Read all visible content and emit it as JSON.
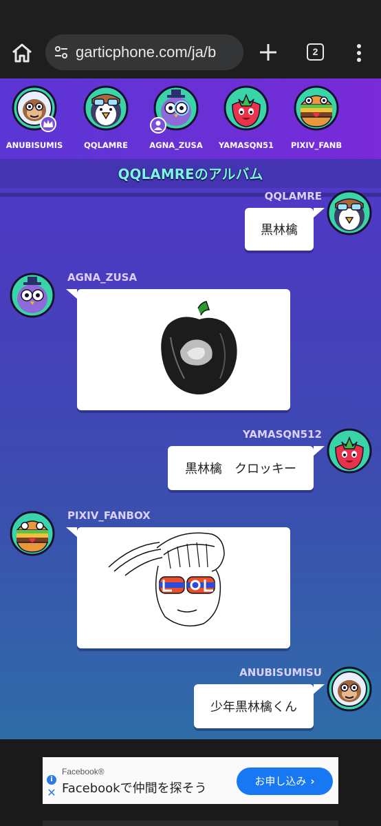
{
  "browser": {
    "url": "garticphone.com/ja/b",
    "tab_count": "2"
  },
  "players": [
    {
      "name": "ANUBISUMIS",
      "avatar": "monkey-astronaut",
      "badge": "crown-icon"
    },
    {
      "name": "QQLAMRE",
      "avatar": "penguin-pilot",
      "badge": ""
    },
    {
      "name": "AGNA_ZUSA",
      "avatar": "owl-detective",
      "badge": "user-icon"
    },
    {
      "name": "YAMASQN51",
      "avatar": "strawberry",
      "badge": ""
    },
    {
      "name": "PIXIV_FANB",
      "avatar": "burger-frog",
      "badge": ""
    }
  ],
  "album": {
    "title": "QQLAMREのアルバム"
  },
  "messages": [
    {
      "author": "QQLAMRE",
      "kind": "text",
      "text": "黒林檎",
      "side": "right"
    },
    {
      "author": "AGNA_ZUSA",
      "kind": "drawing",
      "drawing": "black-apple",
      "side": "left"
    },
    {
      "author": "YAMASQN512",
      "kind": "text",
      "text": "黒林檎　クロッキー",
      "side": "right"
    },
    {
      "author": "PIXIV_FANBOX",
      "kind": "drawing",
      "drawing": "boy-with-lol-glasses",
      "side": "left"
    },
    {
      "author": "ANUBISUMISU",
      "kind": "text",
      "text": "少年黒林檎くん",
      "side": "right"
    }
  ],
  "ad": {
    "brand": "Facebook®",
    "headline": "Facebookで仲間を探そう",
    "cta": "お申し込み"
  },
  "colors": {
    "accent_title": "#7cf2e8",
    "player_bar": "#6b2fd6",
    "cta": "#1877f2"
  }
}
